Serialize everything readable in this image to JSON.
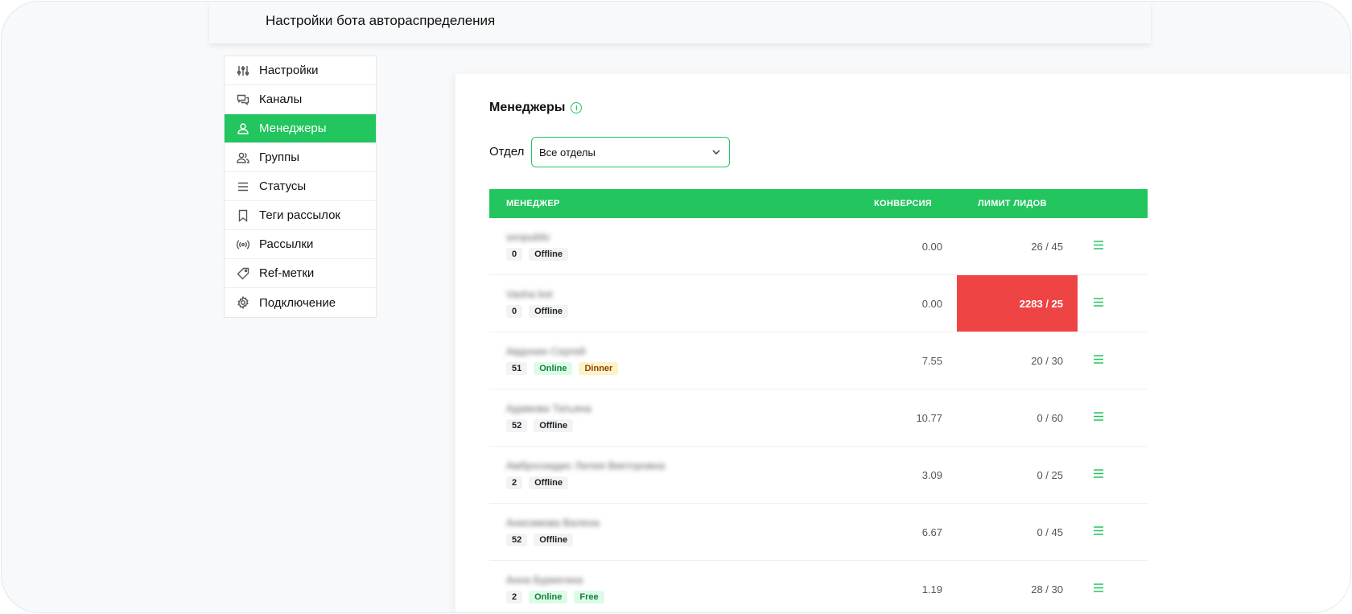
{
  "header": {
    "title": "Настройки бота автораспределения"
  },
  "sidebar": {
    "items": [
      {
        "label": "Настройки",
        "icon": "sliders-icon",
        "active": false
      },
      {
        "label": "Каналы",
        "icon": "chat-bubbles-icon",
        "active": false
      },
      {
        "label": "Менеджеры",
        "icon": "user-icon",
        "active": true
      },
      {
        "label": "Группы",
        "icon": "users-icon",
        "active": false
      },
      {
        "label": "Статусы",
        "icon": "list-icon",
        "active": false
      },
      {
        "label": "Теги рассылок",
        "icon": "bookmark-icon",
        "active": false
      },
      {
        "label": "Рассылки",
        "icon": "broadcast-icon",
        "active": false
      },
      {
        "label": "Ref-метки",
        "icon": "tag-icon",
        "active": false
      },
      {
        "label": "Подключение",
        "icon": "gear-icon",
        "active": false
      }
    ]
  },
  "main": {
    "title": "Менеджеры",
    "filter": {
      "label": "Отдел",
      "value": "Все отделы"
    },
    "table": {
      "columns": {
        "manager": "МЕНЕДЖЕР",
        "conversion": "КОНВЕРСИЯ",
        "limit": "ЛИМИТ ЛИДОВ"
      },
      "rows": [
        {
          "name": "seopublic",
          "count": "0",
          "badges": [
            {
              "text": "Offline",
              "kind": "offline"
            }
          ],
          "conversion": "0.00",
          "limit": "26 / 45",
          "over": false
        },
        {
          "name": "Vasha bot",
          "count": "0",
          "badges": [
            {
              "text": "Offline",
              "kind": "offline"
            }
          ],
          "conversion": "0.00",
          "limit": "2283 / 25",
          "over": true
        },
        {
          "name": "Авдонин Сергей",
          "count": "51",
          "badges": [
            {
              "text": "Online",
              "kind": "online"
            },
            {
              "text": "Dinner",
              "kind": "dinner"
            }
          ],
          "conversion": "7.55",
          "limit": "20 / 30",
          "over": false
        },
        {
          "name": "Адамова Татьяна",
          "count": "52",
          "badges": [
            {
              "text": "Offline",
              "kind": "offline"
            }
          ],
          "conversion": "10.77",
          "limit": "0 / 60",
          "over": false
        },
        {
          "name": "Амбросиадис Лилия Викторовна",
          "count": "2",
          "badges": [
            {
              "text": "Offline",
              "kind": "offline"
            }
          ],
          "conversion": "3.09",
          "limit": "0 / 25",
          "over": false
        },
        {
          "name": "Анисимова Валена",
          "count": "52",
          "badges": [
            {
              "text": "Offline",
              "kind": "offline"
            }
          ],
          "conversion": "6.67",
          "limit": "0 / 45",
          "over": false
        },
        {
          "name": "Анна Буркегина",
          "count": "2",
          "badges": [
            {
              "text": "Online",
              "kind": "online"
            },
            {
              "text": "Free",
              "kind": "free"
            }
          ],
          "conversion": "1.19",
          "limit": "28 / 30",
          "over": false
        }
      ]
    }
  },
  "colors": {
    "accent": "#22c55e",
    "danger": "#ef4444"
  }
}
